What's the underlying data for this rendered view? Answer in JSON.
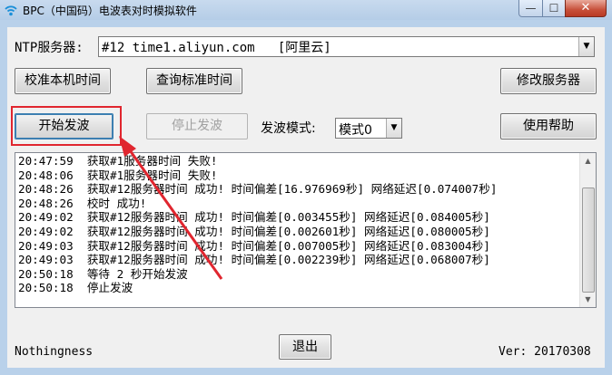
{
  "window": {
    "title": "BPC（中国码）电波表对时模拟软件",
    "app_icon": "wifi-signal-icon",
    "minimize_glyph": "—",
    "maximize_glyph": "☐",
    "close_glyph": "✕"
  },
  "ntp": {
    "label": "NTP服务器:",
    "selected": "#12 time1.aliyun.com   [阿里云]"
  },
  "buttons": {
    "calibrate": "校准本机时间",
    "query": "查询标准时间",
    "modify_server": "修改服务器",
    "start": "开始发波",
    "stop": "停止发波",
    "help": "使用帮助",
    "exit": "退出"
  },
  "mode": {
    "label": "发波模式:",
    "selected": "模式0"
  },
  "log": {
    "lines": [
      "20:47:59  获取#1服务器时间 失败!",
      "20:48:06  获取#1服务器时间 失败!",
      "20:48:26  获取#12服务器时间 成功! 时间偏差[16.976969秒] 网络延迟[0.074007秒]",
      "20:48:26  校时 成功!",
      "20:49:02  获取#12服务器时间 成功! 时间偏差[0.003455秒] 网络延迟[0.084005秒]",
      "20:49:02  获取#12服务器时间 成功! 时间偏差[0.002601秒] 网络延迟[0.080005秒]",
      "20:49:03  获取#12服务器时间 成功! 时间偏差[0.007005秒] 网络延迟[0.083004秒]",
      "20:49:03  获取#12服务器时间 成功! 时间偏差[0.002239秒] 网络延迟[0.068007秒]",
      "20:50:18  等待 2 秒开始发波",
      "20:50:18  停止发波"
    ]
  },
  "footer": {
    "left": "Nothingness",
    "version": "Ver: 20170308"
  },
  "colors": {
    "annotation": "#e0262f",
    "titlebar": "#b9d1ea"
  }
}
